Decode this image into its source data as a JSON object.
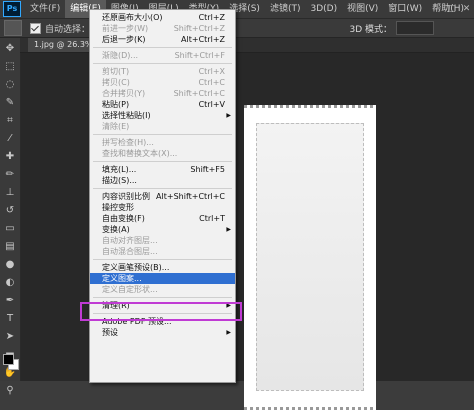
{
  "app": {
    "logo": "Ps"
  },
  "menubar": {
    "items": [
      "文件(F)",
      "编辑(E)",
      "图像(I)",
      "图层(L)",
      "类型(Y)",
      "选择(S)",
      "滤镜(T)",
      "3D(D)",
      "视图(V)",
      "窗口(W)",
      "帮助(H)"
    ],
    "window_buttons": [
      "—",
      "□",
      "✕"
    ]
  },
  "options": {
    "auto_select_label": "自动选择：",
    "mode_label": "3D 模式："
  },
  "tab": {
    "title": "1.jpg @ 26.3% (图"
  },
  "edit_menu": [
    {
      "label": "还原画布大小(O)",
      "shortcut": "Ctrl+Z",
      "disabled": false
    },
    {
      "label": "前进一步(W)",
      "shortcut": "Shift+Ctrl+Z",
      "disabled": true
    },
    {
      "label": "后退一步(K)",
      "shortcut": "Alt+Ctrl+Z",
      "disabled": false
    },
    {
      "sep": true
    },
    {
      "label": "渐隐(D)...",
      "shortcut": "Shift+Ctrl+F",
      "disabled": true
    },
    {
      "sep": true
    },
    {
      "label": "剪切(T)",
      "shortcut": "Ctrl+X",
      "disabled": true
    },
    {
      "label": "拷贝(C)",
      "shortcut": "Ctrl+C",
      "disabled": true
    },
    {
      "label": "合并拷贝(Y)",
      "shortcut": "Shift+Ctrl+C",
      "disabled": true
    },
    {
      "label": "粘贴(P)",
      "shortcut": "Ctrl+V",
      "disabled": false
    },
    {
      "label": "选择性粘贴(I)",
      "shortcut": "",
      "disabled": false,
      "submenu": true
    },
    {
      "label": "清除(E)",
      "shortcut": "",
      "disabled": true
    },
    {
      "sep": true
    },
    {
      "label": "拼写检查(H)...",
      "shortcut": "",
      "disabled": true
    },
    {
      "label": "查找和替换文本(X)...",
      "shortcut": "",
      "disabled": true
    },
    {
      "sep": true
    },
    {
      "label": "填充(L)...",
      "shortcut": "Shift+F5",
      "disabled": false
    },
    {
      "label": "描边(S)...",
      "shortcut": "",
      "disabled": false
    },
    {
      "sep": true
    },
    {
      "label": "内容识别比例",
      "shortcut": "Alt+Shift+Ctrl+C",
      "disabled": false
    },
    {
      "label": "操控变形",
      "shortcut": "",
      "disabled": false
    },
    {
      "label": "自由变换(F)",
      "shortcut": "Ctrl+T",
      "disabled": false
    },
    {
      "label": "变换(A)",
      "shortcut": "",
      "disabled": false,
      "submenu": true
    },
    {
      "label": "自动对齐图层...",
      "shortcut": "",
      "disabled": true
    },
    {
      "label": "自动混合图层...",
      "shortcut": "",
      "disabled": true
    },
    {
      "sep": true
    },
    {
      "label": "定义画笔预设(B)...",
      "shortcut": "",
      "disabled": false
    },
    {
      "label": "定义图案...",
      "shortcut": "",
      "disabled": false,
      "highlighted": true
    },
    {
      "label": "定义自定形状...",
      "shortcut": "",
      "disabled": true
    },
    {
      "sep": true
    },
    {
      "label": "清理(R)",
      "shortcut": "",
      "disabled": false,
      "submenu": true
    },
    {
      "sep": true
    },
    {
      "label": "Adobe PDF 预设...",
      "shortcut": "",
      "disabled": false
    },
    {
      "label": "预设",
      "shortcut": "",
      "disabled": false,
      "submenu": true
    }
  ],
  "colors": {
    "menu_highlight": "#2f6fd1",
    "highlight_frame": "#c03bd4"
  }
}
